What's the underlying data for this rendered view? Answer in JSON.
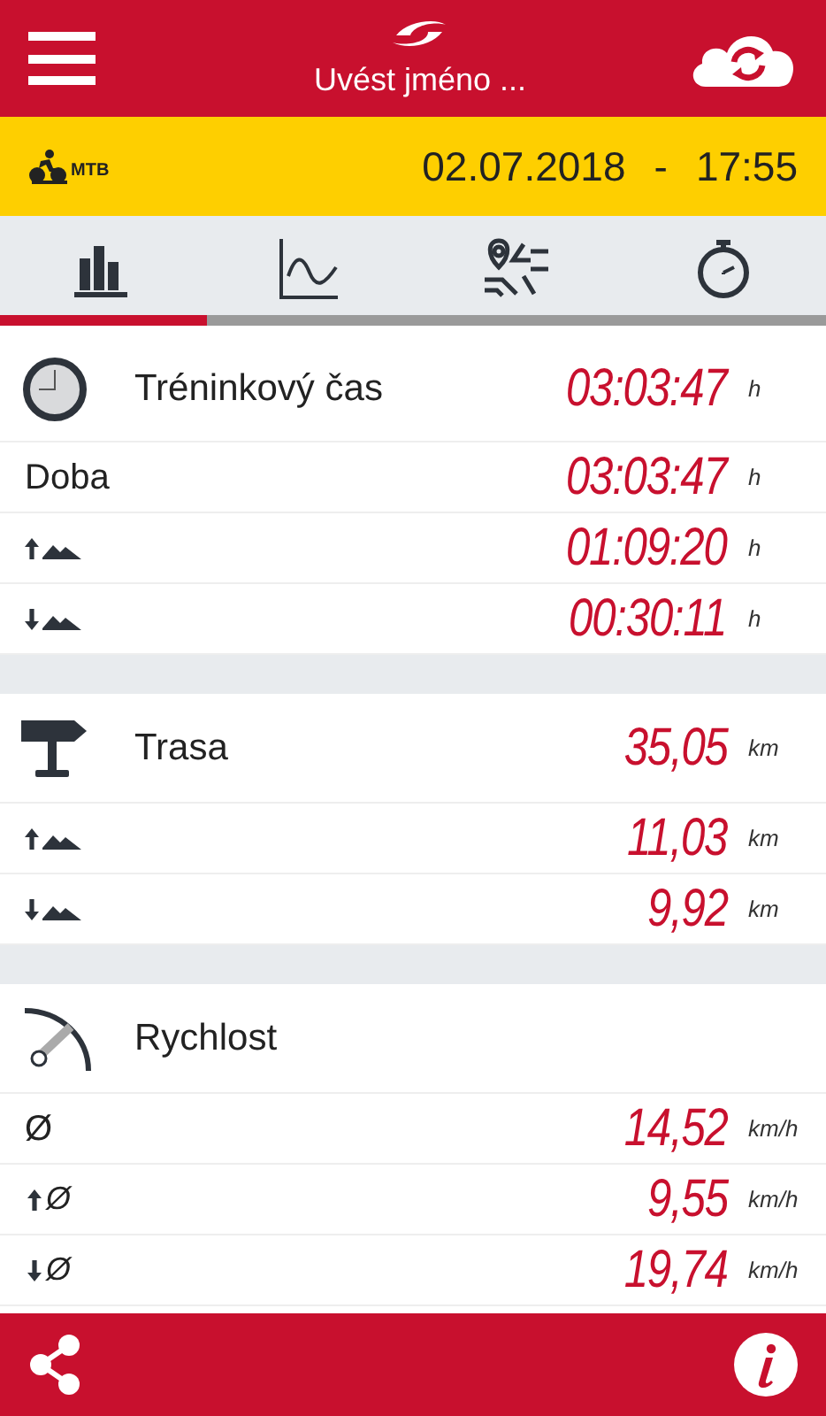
{
  "header": {
    "title": "Uvést jméno ..."
  },
  "activity": {
    "sport": "MTB",
    "date": "02.07.2018",
    "separator": "-",
    "time": "17:55"
  },
  "tabs": [
    {
      "kind": "stats",
      "selected": true
    },
    {
      "kind": "graph",
      "selected": false
    },
    {
      "kind": "route",
      "selected": false
    },
    {
      "kind": "laps",
      "selected": false
    }
  ],
  "sections": [
    {
      "kind": "time",
      "title": "Tréninkový čas",
      "value": "03:03:47",
      "unit": "h",
      "rows": [
        {
          "kind": "text",
          "label": "Doba",
          "value": "03:03:47",
          "unit": "h"
        },
        {
          "kind": "uphill",
          "value": "01:09:20",
          "unit": "h"
        },
        {
          "kind": "downhill",
          "value": "00:30:11",
          "unit": "h"
        }
      ]
    },
    {
      "kind": "distance",
      "title": "Trasa",
      "value": "35,05",
      "unit": "km",
      "rows": [
        {
          "kind": "uphill",
          "value": "11,03",
          "unit": "km"
        },
        {
          "kind": "downhill",
          "value": "9,92",
          "unit": "km"
        }
      ]
    },
    {
      "kind": "speed",
      "title": "Rychlost",
      "rows": [
        {
          "kind": "text",
          "label": "Ø",
          "value": "14,52",
          "unit": "km/h"
        },
        {
          "kind": "avg-up",
          "label": "Ø",
          "value": "9,55",
          "unit": "km/h"
        },
        {
          "kind": "avg-down",
          "label": "Ø",
          "value": "19,74",
          "unit": "km/h"
        }
      ]
    }
  ]
}
